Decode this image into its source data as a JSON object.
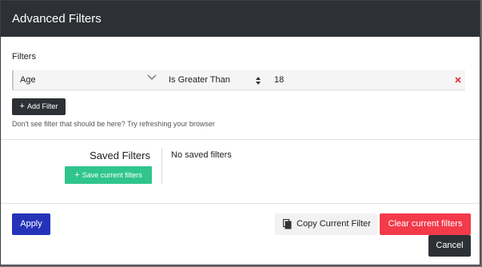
{
  "modal": {
    "title": "Advanced Filters"
  },
  "filters": {
    "label": "Filters",
    "rows": [
      {
        "field": "Age",
        "operator": "Is Greater Than",
        "value": "18"
      }
    ],
    "add_filter_icon": "+",
    "add_filter_label": "Add Filter",
    "hint": "Don't see filter that should be here? Try refreshing your browser"
  },
  "saved": {
    "title": "Saved Filters",
    "save_icon": "+",
    "save_label": "Save current filters",
    "empty_text": "No saved filters"
  },
  "footer": {
    "apply_label": "Apply",
    "copy_label": "Copy Current Filter",
    "clear_label": "Clear current filters",
    "cancel_label": "Cancel"
  },
  "colors": {
    "header_bg": "#2d3135",
    "apply_bg": "#2433b8",
    "save_bg": "#2fc58d",
    "clear_bg": "#f23a4a",
    "remove_x": "#e52b3a"
  },
  "icons": {
    "field_chevron": "chevron-down-icon",
    "operator_updown": "updown-arrows-icon",
    "remove": "close-icon",
    "copy": "copy-icon",
    "add": "plus-icon"
  }
}
